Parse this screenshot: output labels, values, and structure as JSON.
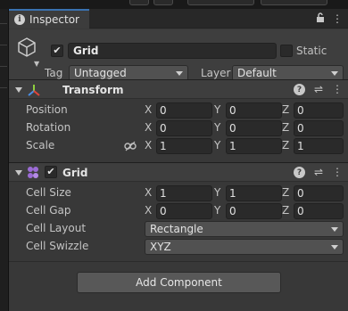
{
  "tab": {
    "title": "Inspector"
  },
  "object": {
    "name": "Grid",
    "active": true,
    "static_label": "Static",
    "static": false
  },
  "tag": {
    "label": "Tag",
    "value": "Untagged"
  },
  "layer": {
    "label": "Layer",
    "value": "Default"
  },
  "transform": {
    "title": "Transform",
    "rows": [
      {
        "label": "Position",
        "x": "0",
        "y": "0",
        "z": "0"
      },
      {
        "label": "Rotation",
        "x": "0",
        "y": "0",
        "z": "0"
      },
      {
        "label": "Scale",
        "x": "1",
        "y": "1",
        "z": "1"
      }
    ]
  },
  "grid": {
    "title": "Grid",
    "enabled": true,
    "cell_size": {
      "label": "Cell Size",
      "x": "1",
      "y": "1",
      "z": "0"
    },
    "cell_gap": {
      "label": "Cell Gap",
      "x": "0",
      "y": "0",
      "z": "0"
    },
    "cell_layout": {
      "label": "Cell Layout",
      "value": "Rectangle"
    },
    "cell_swizzle": {
      "label": "Cell Swizzle",
      "value": "XYZ"
    }
  },
  "axes": {
    "x": "X",
    "y": "Y",
    "z": "Z"
  },
  "add_component_label": "Add Component",
  "colors": {
    "accent": "#3a72b0",
    "panel": "#383838",
    "field": "#2a2a2a",
    "dropdown": "#515151"
  }
}
